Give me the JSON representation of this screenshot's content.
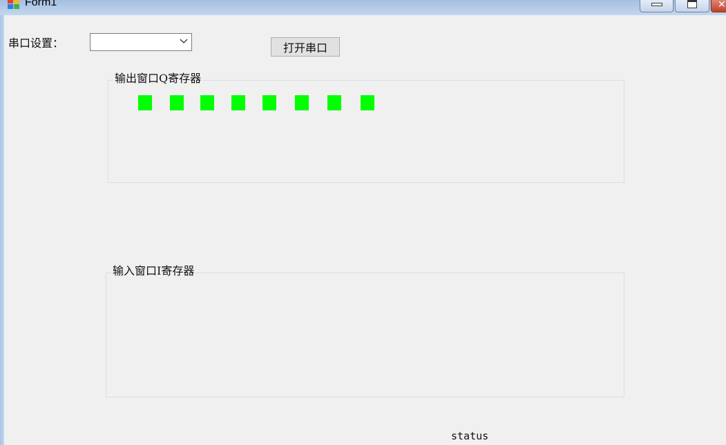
{
  "window": {
    "title": "Form1",
    "controls": {
      "minimize_icon": "minimize-icon",
      "maximize_icon": "maximize-icon",
      "close_icon": "close-icon"
    }
  },
  "serial": {
    "label": "串口设置：",
    "port_value": "",
    "open_button_label": "打开串口"
  },
  "output_group": {
    "title": "输出窗口Q寄存器",
    "leds": [
      {
        "state": "on",
        "color": "#00ff00"
      },
      {
        "state": "on",
        "color": "#00ff00"
      },
      {
        "state": "on",
        "color": "#00ff00"
      },
      {
        "state": "on",
        "color": "#00ff00"
      },
      {
        "state": "on",
        "color": "#00ff00"
      },
      {
        "state": "on",
        "color": "#00ff00"
      },
      {
        "state": "on",
        "color": "#00ff00"
      },
      {
        "state": "on",
        "color": "#00ff00"
      }
    ]
  },
  "input_group": {
    "title": "输入窗口I寄存器"
  },
  "status_text": "status"
}
